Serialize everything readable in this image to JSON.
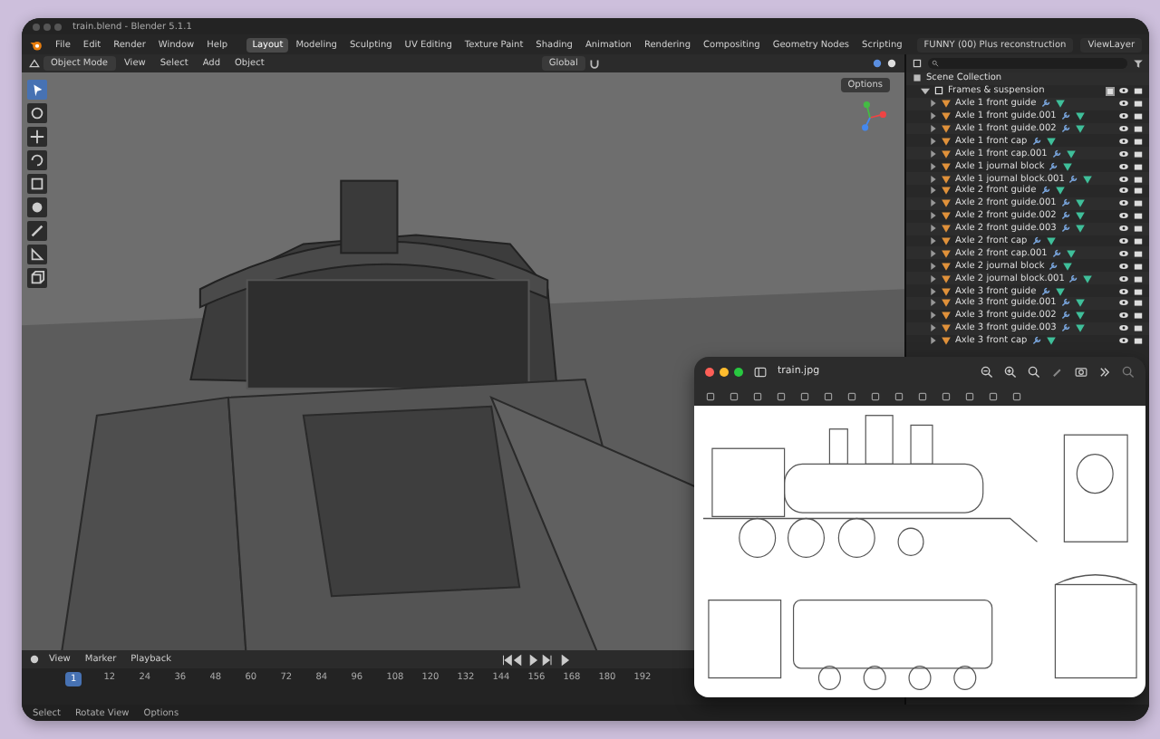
{
  "window": {
    "title": "train.blend - Blender 5.1.1"
  },
  "menu": [
    "File",
    "Edit",
    "Render",
    "Window",
    "Help"
  ],
  "workspaces": [
    {
      "label": "Layout",
      "selected": true
    },
    {
      "label": "Modeling",
      "selected": false
    },
    {
      "label": "Sculpting",
      "selected": false
    },
    {
      "label": "UV Editing",
      "selected": false
    },
    {
      "label": "Texture Paint",
      "selected": false
    },
    {
      "label": "Shading",
      "selected": false
    },
    {
      "label": "Animation",
      "selected": false
    },
    {
      "label": "Rendering",
      "selected": false
    },
    {
      "label": "Compositing",
      "selected": false
    },
    {
      "label": "Geometry Nodes",
      "selected": false
    },
    {
      "label": "Scripting",
      "selected": false
    }
  ],
  "scene": {
    "name": "FUNNY (00) Plus reconstruction",
    "view_layer": "ViewLayer"
  },
  "viewport_header": {
    "mode": "Object Mode",
    "menus": [
      "View",
      "Select",
      "Add",
      "Object"
    ],
    "orientation": "Global",
    "options": "Options"
  },
  "tools": [
    {
      "kind": "select",
      "selected": true
    },
    {
      "kind": "cursor",
      "selected": false
    },
    {
      "kind": "move",
      "selected": false
    },
    {
      "kind": "rotate",
      "selected": false
    },
    {
      "kind": "scale",
      "selected": false
    },
    {
      "kind": "transform",
      "selected": false
    },
    {
      "kind": "annotate",
      "selected": false
    },
    {
      "kind": "measure",
      "selected": false
    },
    {
      "kind": "add-cube",
      "selected": false
    }
  ],
  "outliner": {
    "root": "Scene Collection",
    "collection": {
      "name": "Frames & suspension",
      "expanded": true,
      "checked": true
    },
    "items": [
      "Axle 1 front guide",
      "Axle 1 front guide.001",
      "Axle 1 front guide.002",
      "Axle 1 front cap",
      "Axle 1 front cap.001",
      "Axle 1 journal block",
      "Axle 1 journal block.001",
      "Axle 2 front guide",
      "Axle 2 front guide.001",
      "Axle 2 front guide.002",
      "Axle 2 front guide.003",
      "Axle 2 front cap",
      "Axle 2 front cap.001",
      "Axle 2 journal block",
      "Axle 2 journal block.001",
      "Axle 3 front guide",
      "Axle 3 front guide.001",
      "Axle 3 front guide.002",
      "Axle 3 front guide.003",
      "Axle 3 front cap"
    ]
  },
  "timeline": {
    "menus": [
      "View",
      "Marker",
      "Playback"
    ],
    "current_frame": "1",
    "ticks": [
      "12",
      "24",
      "36",
      "48",
      "60",
      "72",
      "84",
      "96",
      "108",
      "120",
      "132",
      "144",
      "156",
      "168",
      "180",
      "192"
    ]
  },
  "status_bar": [
    "Select",
    "Rotate View",
    "Options"
  ],
  "preview": {
    "title": "train.jpg"
  }
}
